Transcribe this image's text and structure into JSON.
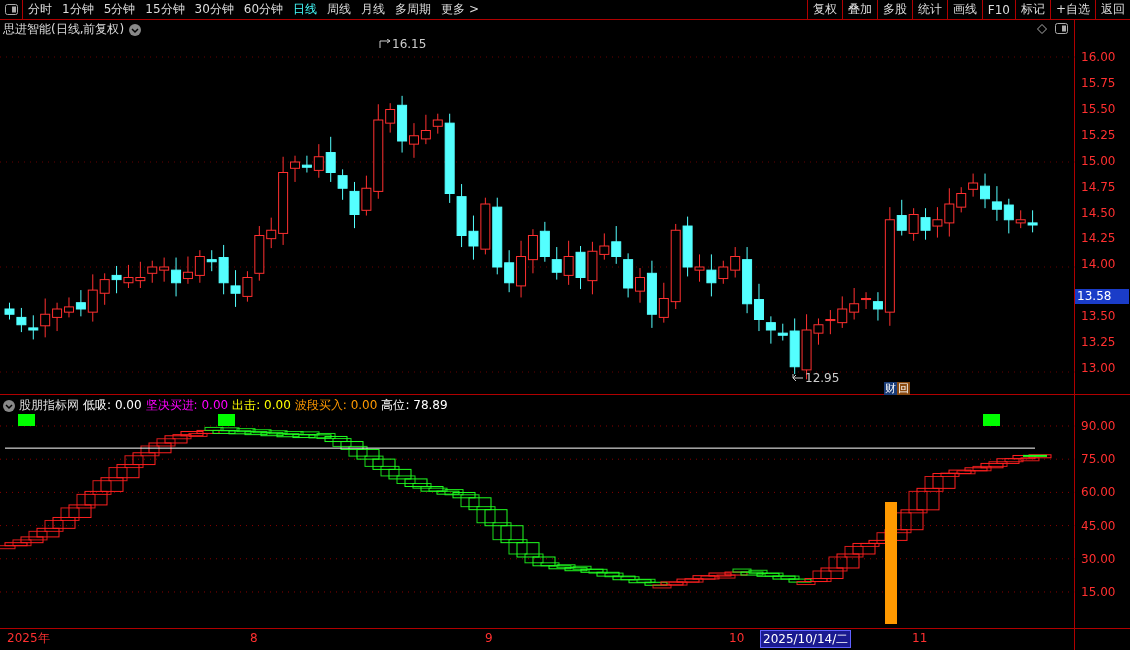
{
  "toolbar": {
    "periods": [
      {
        "label": "分时",
        "selected": false
      },
      {
        "label": "1分钟",
        "selected": false
      },
      {
        "label": "5分钟",
        "selected": false
      },
      {
        "label": "15分钟",
        "selected": false
      },
      {
        "label": "30分钟",
        "selected": false
      },
      {
        "label": "60分钟",
        "selected": false
      },
      {
        "label": "日线",
        "selected": true
      },
      {
        "label": "周线",
        "selected": false
      },
      {
        "label": "月线",
        "selected": false
      },
      {
        "label": "多周期",
        "selected": false
      },
      {
        "label": "更多 >",
        "selected": false
      }
    ],
    "actions": [
      "复权",
      "叠加",
      "多股",
      "统计",
      "画线",
      "F10",
      "标记",
      "+自选",
      "返回"
    ]
  },
  "price_pane": {
    "title": "思进智能(日线,前复权)",
    "high_label": "16.15",
    "low_label": "12.95",
    "badges": [
      "财",
      "回"
    ],
    "axis_labels": [
      {
        "label": "16.00",
        "kind": "tick"
      },
      {
        "label": "15.75",
        "kind": "tick"
      },
      {
        "label": "15.50",
        "kind": "tick"
      },
      {
        "label": "15.25",
        "kind": "tick"
      },
      {
        "label": "15.00",
        "kind": "tick"
      },
      {
        "label": "14.75",
        "kind": "tick"
      },
      {
        "label": "14.50",
        "kind": "tick"
      },
      {
        "label": "14.25",
        "kind": "tick"
      },
      {
        "label": "14.00",
        "kind": "tick"
      },
      {
        "label": "13.58",
        "kind": "current"
      },
      {
        "label": "13.50",
        "kind": "tick"
      },
      {
        "label": "13.25",
        "kind": "tick"
      },
      {
        "label": "13.00",
        "kind": "tick"
      }
    ]
  },
  "indicator_pane": {
    "name": "股朋指标网",
    "legend": [
      {
        "label": "低吸:",
        "value": "0.00",
        "color": "#ffffff"
      },
      {
        "label": "坚决买进:",
        "value": "0.00",
        "color": "#ff00ff"
      },
      {
        "label": "出击:",
        "value": "0.00",
        "color": "#ffff00"
      },
      {
        "label": "波段买入:",
        "value": "0.00",
        "color": "#ff9900"
      },
      {
        "label": "高位:",
        "value": "78.89",
        "color": "#ffffff"
      }
    ],
    "axis_labels": [
      "90.00",
      "75.00",
      "60.00",
      "45.00",
      "30.00",
      "15.00"
    ]
  },
  "time_axis": {
    "labels": [
      {
        "label": "2025年",
        "selected": false
      },
      {
        "label": "8",
        "selected": false
      },
      {
        "label": "9",
        "selected": false
      },
      {
        "label": "10",
        "selected": false
      },
      {
        "label": "2025/10/14/二",
        "selected": true
      },
      {
        "label": "11",
        "selected": false
      }
    ]
  }
}
